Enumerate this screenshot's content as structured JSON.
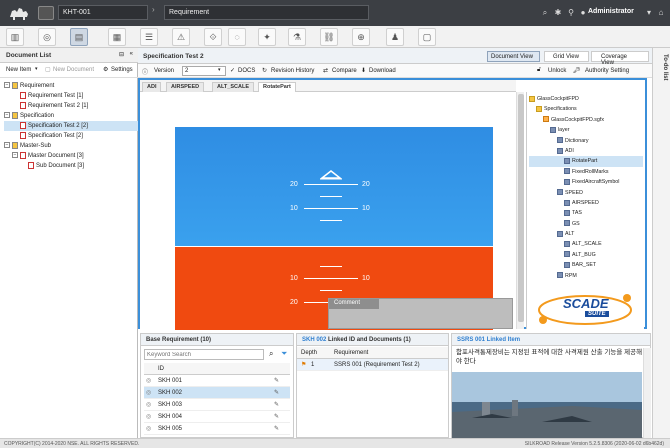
{
  "topbar": {
    "project": "KHT-001",
    "breadcrumb": "Requirement",
    "user": "Administrator"
  },
  "left_panel": {
    "title": "Document List",
    "new_item": "New Item",
    "new_document": "New Document",
    "settings": "Settings",
    "tree": [
      {
        "label": "Requirement",
        "level": 0,
        "type": "folder"
      },
      {
        "label": "Requirement Test [1]",
        "level": 1,
        "type": "doc"
      },
      {
        "label": "Requirement Test 2 [1]",
        "level": 1,
        "type": "doc"
      },
      {
        "label": "Specification",
        "level": 0,
        "type": "folder"
      },
      {
        "label": "Specification Test 2 [2]",
        "level": 1,
        "type": "doc",
        "selected": true
      },
      {
        "label": "Specification Test [2]",
        "level": 1,
        "type": "doc"
      },
      {
        "label": "Master-Sub",
        "level": 0,
        "type": "folder"
      },
      {
        "label": "Master Document [3]",
        "level": 1,
        "type": "doc"
      },
      {
        "label": "Sub Document [3]",
        "level": 2,
        "type": "doc"
      }
    ]
  },
  "main": {
    "title": "Specification Test 2",
    "views": [
      "Document View",
      "Grid View",
      "Coverage View"
    ],
    "version_label": "Version",
    "version_value": "2",
    "docs": "DOCS",
    "revision_history": "Revision History",
    "compare": "Compare",
    "download": "Download",
    "unlock": "Unlock",
    "authority_setting": "Authority Setting"
  },
  "viewer": {
    "tabs": [
      "ADI",
      "AIRSPEED",
      "ALT_SCALE",
      "RotatePart"
    ],
    "pitch_labels": {
      "up20": "20",
      "up10": "10",
      "down10": "10",
      "down20": "20"
    },
    "comment_title": "Comment",
    "scade_logo": "SCADE",
    "scade_sub": "SUITE",
    "tree": [
      {
        "label": "GlassCockpitFPD",
        "level": 0,
        "type": "folder"
      },
      {
        "label": "Specifications",
        "level": 1,
        "type": "folder"
      },
      {
        "label": "GlassCockpitFPD.sgfx",
        "level": 2,
        "type": "file"
      },
      {
        "label": "layer",
        "level": 3,
        "type": "node"
      },
      {
        "label": "Dictionary",
        "level": 4,
        "type": "node"
      },
      {
        "label": "ADI",
        "level": 4,
        "type": "node"
      },
      {
        "label": "RotatePart",
        "level": 5,
        "type": "node",
        "selected": true
      },
      {
        "label": "FixedRollMarks",
        "level": 5,
        "type": "node"
      },
      {
        "label": "FixedAircraftSymbol",
        "level": 5,
        "type": "node"
      },
      {
        "label": "SPEED",
        "level": 4,
        "type": "node"
      },
      {
        "label": "AIRSPEED",
        "level": 5,
        "type": "node"
      },
      {
        "label": "TAS",
        "level": 5,
        "type": "node"
      },
      {
        "label": "GS",
        "level": 5,
        "type": "node"
      },
      {
        "label": "ALT",
        "level": 4,
        "type": "node"
      },
      {
        "label": "ALT_SCALE",
        "level": 5,
        "type": "node"
      },
      {
        "label": "ALT_BUG",
        "level": 5,
        "type": "node"
      },
      {
        "label": "BAR_SET",
        "level": 5,
        "type": "node"
      },
      {
        "label": "RPM",
        "level": 4,
        "type": "node"
      }
    ]
  },
  "base_requirement": {
    "title": "Base Requirement (10)",
    "search_placeholder": "Keyword Search",
    "column_id": "ID",
    "rows": [
      "SKH 001",
      "SKH 002",
      "SKH 003",
      "SKH 004",
      "SKH 005"
    ],
    "selected_index": 1
  },
  "linked_docs": {
    "title_prefix": "SKH 002",
    "title_rest": " Linked ID and Documents (1)",
    "columns": [
      "Depth",
      "Requirement"
    ],
    "rows": [
      {
        "depth": "1",
        "requirement": "SSRS 001 (Requirement Test 2)"
      }
    ]
  },
  "linked_item": {
    "title": "SSRS 001 Linked Item",
    "text": "함포사격통제장비는 지정된 표적에 대한 사격제원 산출 기능을 제공해야 한다"
  },
  "todo": {
    "label": "To-do list"
  },
  "footer": {
    "copyright": "COPYRIGHT(C) 2014-2020 NSE. ALL RIGHTS RESERVED.",
    "release": "SILKROAD Release Version 5.2.5.8306 (2020-06-02 d6b462d)"
  },
  "colors": {
    "topbar": "#3c3f44",
    "sky": "#2f8de3",
    "ground": "#f04a10",
    "viewer_border": "#3b8fd9",
    "selection": "#cde3f5"
  }
}
